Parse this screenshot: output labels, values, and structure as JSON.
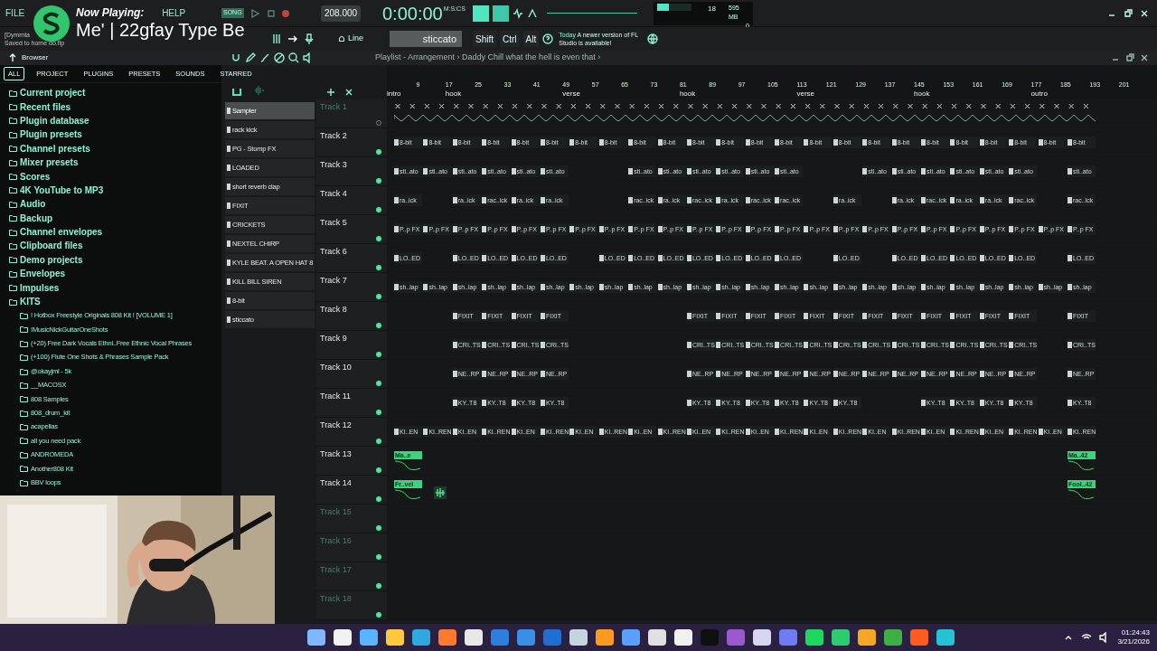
{
  "menu": [
    "FILE",
    "HELP"
  ],
  "now_playing": {
    "heading": "Now Playing:",
    "track": "Me' | 22gfay Type Be"
  },
  "hint_lines": [
    "[Dymmta",
    "Saved to home do.flp"
  ],
  "transport": {
    "mode": "SONG",
    "tempo": "208.000",
    "time": "0:00:00",
    "time_unit": "M:S:CS"
  },
  "monitor": {
    "cpu": "18",
    "memory": "595 MB",
    "voices": "0",
    "cpu_meter": {
      "level": 0.35
    }
  },
  "toolbar": {
    "snap": "Line",
    "pattern": "sticcato",
    "keys": [
      "Shift",
      "Ctrl",
      "Alt"
    ],
    "news_day": "Today",
    "news": "A newer version of FL Studio is available!"
  },
  "browser": {
    "title": "Browser",
    "tabs": [
      {
        "label": "ALL",
        "selected": true
      },
      {
        "label": "PROJECT",
        "selected": false
      },
      {
        "label": "PLUGINS",
        "selected": false
      },
      {
        "label": "PRESETS",
        "selected": false
      },
      {
        "label": "SOUNDS",
        "selected": false
      },
      {
        "label": "STARRED",
        "selected": false
      }
    ],
    "items": [
      {
        "label": "Current project"
      },
      {
        "label": "Recent files"
      },
      {
        "label": "Plugin database"
      },
      {
        "label": "Plugin presets"
      },
      {
        "label": "Channel presets"
      },
      {
        "label": "Mixer presets"
      },
      {
        "label": "Scores"
      },
      {
        "label": "4K YouTube to MP3"
      },
      {
        "label": "Audio"
      },
      {
        "label": "Backup"
      },
      {
        "label": "Channel envelopes"
      },
      {
        "label": "Clipboard files"
      },
      {
        "label": "Demo projects"
      },
      {
        "label": "Envelopes"
      },
      {
        "label": "Impulses"
      },
      {
        "label": "KITS",
        "expanded": true,
        "children": [
          {
            "label": "! Hotbox Freestyle Originals 808 Kit ! [VOLUME 1]"
          },
          {
            "label": "!MusicNickGuitarOneShots"
          },
          {
            "label": "(+20) Free Dark Vocals  Ethni..Free Ethnic Vocal Phrases"
          },
          {
            "label": "(+100) Flute One Shots & Phrases Sample Pack"
          },
          {
            "label": "@okayjml - 5k"
          },
          {
            "label": "__MACOSX"
          },
          {
            "label": "808 Samples"
          },
          {
            "label": "808_drum_kit"
          },
          {
            "label": "acapellas"
          },
          {
            "label": "all you need pack"
          },
          {
            "label": "ANDROMEDA"
          },
          {
            "label": "Another808 Kit"
          },
          {
            "label": "BBV loops"
          }
        ]
      }
    ]
  },
  "channels": [
    {
      "label": "Sampler",
      "selected": true
    },
    {
      "label": "rack kick",
      "selected": false
    },
    {
      "label": "PG - Stomp FX",
      "selected": false
    },
    {
      "label": "LOADED",
      "selected": false
    },
    {
      "label": "short reverb clap",
      "selected": false
    },
    {
      "label": "FIXIT",
      "selected": false
    },
    {
      "label": "CRICKETS",
      "selected": false
    },
    {
      "label": "NEXTEL CHIRP",
      "selected": false
    },
    {
      "label": "KYLE BEAT. A OPEN HAT 8",
      "selected": false
    },
    {
      "label": "KILL BILL SIREN",
      "selected": false
    },
    {
      "label": "8-bit",
      "selected": false
    },
    {
      "label": "sticcato",
      "selected": false
    }
  ],
  "playlist": {
    "title": "Playlist - Arrangement",
    "separator": "›",
    "song": "Daddy Chill what the hell is even that",
    "end": "›",
    "ruler": [
      {
        "marker": "intro"
      },
      {
        "bar": "9"
      },
      {
        "bar": "17",
        "marker": "hook"
      },
      {
        "bar": "25"
      },
      {
        "bar": "33"
      },
      {
        "bar": "41"
      },
      {
        "bar": "49",
        "marker": "verse"
      },
      {
        "bar": "57"
      },
      {
        "bar": "65"
      },
      {
        "bar": "73"
      },
      {
        "bar": "81",
        "marker": "hook"
      },
      {
        "bar": "89"
      },
      {
        "bar": "97"
      },
      {
        "bar": "105"
      },
      {
        "bar": "113",
        "marker": "verse"
      },
      {
        "bar": "121"
      },
      {
        "bar": "129"
      },
      {
        "bar": "137"
      },
      {
        "bar": "145",
        "marker": "hook"
      },
      {
        "bar": "153"
      },
      {
        "bar": "161"
      },
      {
        "bar": "169"
      },
      {
        "bar": "177",
        "marker": "outro"
      },
      {
        "bar": "185"
      },
      {
        "bar": "193"
      },
      {
        "bar": "201"
      }
    ],
    "tracks": [
      {
        "name": "Track 1",
        "kind": "waveform",
        "muted": true
      },
      {
        "name": "Track 2",
        "kind": "pattern",
        "muted": false,
        "slots": [
          {
            "kind": "clip",
            "label": "8-bit"
          },
          {
            "kind": "clip",
            "label": "8-bit"
          },
          {
            "kind": "clip",
            "label": "8-bit"
          },
          {
            "kind": "clip",
            "label": "8-bit"
          },
          {
            "kind": "clip",
            "label": "8-bit"
          },
          {
            "kind": "clip",
            "label": "8-bit"
          },
          {
            "kind": "clip",
            "label": "8-bit"
          },
          {
            "kind": "clip",
            "label": "8-bit"
          },
          {
            "kind": "clip",
            "label": "8-bit"
          },
          {
            "kind": "clip",
            "label": "8-bit"
          },
          {
            "kind": "clip",
            "label": "8-bit"
          },
          {
            "kind": "clip",
            "label": "8-bit"
          },
          {
            "kind": "clip",
            "label": "8-bit"
          },
          {
            "kind": "clip",
            "label": "8-bit"
          },
          {
            "kind": "clip",
            "label": "8-bit"
          },
          {
            "kind": "clip",
            "label": "8-bit"
          },
          {
            "kind": "clip",
            "label": "8-bit"
          },
          {
            "kind": "clip",
            "label": "8-bit"
          },
          {
            "kind": "clip",
            "label": "8-bit"
          },
          {
            "kind": "clip",
            "label": "8-bit"
          },
          {
            "kind": "clip",
            "label": "8-bit"
          },
          {
            "kind": "clip",
            "label": "8-bit"
          },
          {
            "kind": "clip",
            "label": "8-bit"
          },
          {
            "kind": "clip",
            "label": "8-bit"
          }
        ]
      },
      {
        "name": "Track 3",
        "kind": "pattern",
        "muted": false,
        "slots": [
          {
            "kind": "clip",
            "label": "sti..ato"
          },
          {
            "kind": "clip",
            "label": "sti..ato"
          },
          {
            "kind": "clip",
            "label": "sti..ato"
          },
          {
            "kind": "clip",
            "label": "sti..ato"
          },
          {
            "kind": "clip",
            "label": "sti..ato"
          },
          {
            "kind": "clip",
            "label": "sti..ato"
          },
          {
            "kind": "gap"
          },
          {
            "kind": "gap"
          },
          {
            "kind": "clip",
            "label": "sti..ato"
          },
          {
            "kind": "clip",
            "label": "sti..ato"
          },
          {
            "kind": "clip",
            "label": "sti..ato"
          },
          {
            "kind": "clip",
            "label": "sti..ato"
          },
          {
            "kind": "clip",
            "label": "sti..ato"
          },
          {
            "kind": "clip",
            "label": "sti..ato"
          },
          {
            "kind": "gap"
          },
          {
            "kind": "gap"
          },
          {
            "kind": "clip",
            "label": "sti..ato"
          },
          {
            "kind": "clip",
            "label": "sti..ato"
          },
          {
            "kind": "clip",
            "label": "sti..ato"
          },
          {
            "kind": "clip",
            "label": "sti..ato"
          },
          {
            "kind": "clip",
            "label": "sti..ato"
          },
          {
            "kind": "clip",
            "label": "sti..ato"
          },
          {
            "kind": "gap"
          },
          {
            "kind": "clip",
            "label": "sti..ato"
          }
        ]
      },
      {
        "name": "Track 4",
        "kind": "pattern",
        "muted": false,
        "slots": [
          {
            "kind": "clip",
            "label": "ra..ick"
          },
          {
            "kind": "gap"
          },
          {
            "kind": "clip",
            "label": "ra..ick"
          },
          {
            "kind": "clip",
            "label": "rac..ick"
          },
          {
            "kind": "clip",
            "label": "ra..ick"
          },
          {
            "kind": "clip",
            "label": "ra..ick"
          },
          {
            "kind": "gap"
          },
          {
            "kind": "gap"
          },
          {
            "kind": "clip",
            "label": "rac..ick"
          },
          {
            "kind": "clip",
            "label": "ra..ick"
          },
          {
            "kind": "clip",
            "label": "rac..ick"
          },
          {
            "kind": "clip",
            "label": "ra..ick"
          },
          {
            "kind": "clip",
            "label": "rac..ick"
          },
          {
            "kind": "clip",
            "label": "rac..ick"
          },
          {
            "kind": "gap"
          },
          {
            "kind": "clip",
            "label": "ra..ick"
          },
          {
            "kind": "gap"
          },
          {
            "kind": "clip",
            "label": "ra..ick"
          },
          {
            "kind": "clip",
            "label": "rac..ick"
          },
          {
            "kind": "clip",
            "label": "ra..ick"
          },
          {
            "kind": "clip",
            "label": "ra..ick"
          },
          {
            "kind": "clip",
            "label": "rac..ick"
          },
          {
            "kind": "gap"
          },
          {
            "kind": "clip",
            "label": "rac..ick"
          }
        ]
      },
      {
        "name": "Track 5",
        "kind": "pattern",
        "muted": false,
        "slots": [
          {
            "kind": "clip",
            "label": "P..p FX"
          },
          {
            "kind": "clip",
            "label": "P..p FX"
          },
          {
            "kind": "clip",
            "label": "P..p FX"
          },
          {
            "kind": "clip",
            "label": "P..p FX"
          },
          {
            "kind": "clip",
            "label": "P..p FX"
          },
          {
            "kind": "clip",
            "label": "P..p FX"
          },
          {
            "kind": "clip",
            "label": "P..p FX"
          },
          {
            "kind": "clip",
            "label": "P..p FX"
          },
          {
            "kind": "clip",
            "label": "P..p FX"
          },
          {
            "kind": "clip",
            "label": "P..p FX"
          },
          {
            "kind": "clip",
            "label": "P..p FX"
          },
          {
            "kind": "clip",
            "label": "P..p FX"
          },
          {
            "kind": "clip",
            "label": "P..p FX"
          },
          {
            "kind": "clip",
            "label": "P..p FX"
          },
          {
            "kind": "clip",
            "label": "P..p FX"
          },
          {
            "kind": "clip",
            "label": "P..p FX"
          },
          {
            "kind": "clip",
            "label": "P..p FX"
          },
          {
            "kind": "clip",
            "label": "P..p FX"
          },
          {
            "kind": "clip",
            "label": "P..p FX"
          },
          {
            "kind": "clip",
            "label": "P..p FX"
          },
          {
            "kind": "clip",
            "label": "P..p FX"
          },
          {
            "kind": "clip",
            "label": "P..p FX"
          },
          {
            "kind": "clip",
            "label": "P..p FX"
          },
          {
            "kind": "clip",
            "label": "P..p FX"
          }
        ]
      },
      {
        "name": "Track 6",
        "kind": "pattern",
        "muted": false,
        "slots": [
          {
            "kind": "clip",
            "label": "LO..ED"
          },
          {
            "kind": "gap"
          },
          {
            "kind": "clip",
            "label": "LO..ED"
          },
          {
            "kind": "clip",
            "label": "LO..ED"
          },
          {
            "kind": "clip",
            "label": "LO..ED"
          },
          {
            "kind": "clip",
            "label": "LO..ED"
          },
          {
            "kind": "gap"
          },
          {
            "kind": "clip",
            "label": "LO..ED"
          },
          {
            "kind": "clip",
            "label": "LO..ED"
          },
          {
            "kind": "clip",
            "label": "LO..ED"
          },
          {
            "kind": "clip",
            "label": "LO..ED"
          },
          {
            "kind": "clip",
            "label": "LO..ED"
          },
          {
            "kind": "clip",
            "label": "LO..ED"
          },
          {
            "kind": "clip",
            "label": "LO..ED"
          },
          {
            "kind": "gap"
          },
          {
            "kind": "clip",
            "label": "LO..ED"
          },
          {
            "kind": "gap"
          },
          {
            "kind": "clip",
            "label": "LO..ED"
          },
          {
            "kind": "clip",
            "label": "LO..ED"
          },
          {
            "kind": "clip",
            "label": "LO..ED"
          },
          {
            "kind": "clip",
            "label": "LO..ED"
          },
          {
            "kind": "clip",
            "label": "LO..ED"
          },
          {
            "kind": "gap"
          },
          {
            "kind": "clip",
            "label": "LO..ED"
          }
        ]
      },
      {
        "name": "Track 7",
        "kind": "pattern",
        "muted": false,
        "slots": [
          {
            "kind": "clip",
            "label": "sh..lap"
          },
          {
            "kind": "clip",
            "label": "sh..lap"
          },
          {
            "kind": "clip",
            "label": "sh..lap"
          },
          {
            "kind": "clip",
            "label": "sh..lap"
          },
          {
            "kind": "clip",
            "label": "sh..lap"
          },
          {
            "kind": "clip",
            "label": "sh..lap"
          },
          {
            "kind": "clip",
            "label": "sh..lap"
          },
          {
            "kind": "clip",
            "label": "sh..lap"
          },
          {
            "kind": "clip",
            "label": "sh..lap"
          },
          {
            "kind": "clip",
            "label": "sh..lap"
          },
          {
            "kind": "clip",
            "label": "sh..lap"
          },
          {
            "kind": "clip",
            "label": "sh..lap"
          },
          {
            "kind": "clip",
            "label": "sh..lap"
          },
          {
            "kind": "clip",
            "label": "sh..lap"
          },
          {
            "kind": "clip",
            "label": "sh..lap"
          },
          {
            "kind": "clip",
            "label": "sh..lap"
          },
          {
            "kind": "clip",
            "label": "sh..lap"
          },
          {
            "kind": "clip",
            "label": "sh..lap"
          },
          {
            "kind": "clip",
            "label": "sh..lap"
          },
          {
            "kind": "clip",
            "label": "sh..lap"
          },
          {
            "kind": "clip",
            "label": "sh..lap"
          },
          {
            "kind": "clip",
            "label": "sh..lap"
          },
          {
            "kind": "clip",
            "label": "sh..lap"
          },
          {
            "kind": "clip",
            "label": "sh..lap"
          }
        ]
      },
      {
        "name": "Track 8",
        "kind": "pattern",
        "muted": false,
        "slots": [
          {
            "kind": "gap"
          },
          {
            "kind": "gap"
          },
          {
            "kind": "clip",
            "label": "FIXIT"
          },
          {
            "kind": "clip",
            "label": "FIXIT"
          },
          {
            "kind": "clip",
            "label": "FIXIT"
          },
          {
            "kind": "clip",
            "label": "FIXIT"
          },
          {
            "kind": "gap"
          },
          {
            "kind": "gap"
          },
          {
            "kind": "gap"
          },
          {
            "kind": "gap"
          },
          {
            "kind": "clip",
            "label": "FIXIT"
          },
          {
            "kind": "clip",
            "label": "FIXIT"
          },
          {
            "kind": "clip",
            "label": "FIXIT"
          },
          {
            "kind": "clip",
            "label": "FIXIT"
          },
          {
            "kind": "clip",
            "label": "FIXIT"
          },
          {
            "kind": "clip",
            "label": "FIXIT"
          },
          {
            "kind": "clip",
            "label": "FIXIT"
          },
          {
            "kind": "clip",
            "label": "FIXIT"
          },
          {
            "kind": "clip",
            "label": "FIXIT"
          },
          {
            "kind": "clip",
            "label": "FIXIT"
          },
          {
            "kind": "clip",
            "label": "FIXIT"
          },
          {
            "kind": "clip",
            "label": "FIXIT"
          },
          {
            "kind": "gap"
          },
          {
            "kind": "clip",
            "label": "FIXIT"
          }
        ]
      },
      {
        "name": "Track 9",
        "kind": "pattern",
        "muted": false,
        "slots": [
          {
            "kind": "gap"
          },
          {
            "kind": "gap"
          },
          {
            "kind": "clip",
            "label": "CRI..TS"
          },
          {
            "kind": "clip",
            "label": "CRI..TS"
          },
          {
            "kind": "clip",
            "label": "CRI..TS"
          },
          {
            "kind": "clip",
            "label": "CRI..TS"
          },
          {
            "kind": "gap"
          },
          {
            "kind": "gap"
          },
          {
            "kind": "gap"
          },
          {
            "kind": "gap"
          },
          {
            "kind": "clip",
            "label": "CRI..TS"
          },
          {
            "kind": "clip",
            "label": "CRI..TS"
          },
          {
            "kind": "clip",
            "label": "CRI..TS"
          },
          {
            "kind": "clip",
            "label": "CRI..TS"
          },
          {
            "kind": "clip",
            "label": "CRI..TS"
          },
          {
            "kind": "clip",
            "label": "CRI..TS"
          },
          {
            "kind": "clip",
            "label": "CRI..TS"
          },
          {
            "kind": "clip",
            "label": "CRI..TS"
          },
          {
            "kind": "clip",
            "label": "CRI..TS"
          },
          {
            "kind": "clip",
            "label": "CRI..TS"
          },
          {
            "kind": "clip",
            "label": "CRI..TS"
          },
          {
            "kind": "clip",
            "label": "CRI..TS"
          },
          {
            "kind": "gap"
          },
          {
            "kind": "clip",
            "label": "CRI..TS"
          }
        ]
      },
      {
        "name": "Track 10",
        "kind": "pattern",
        "muted": false,
        "slots": [
          {
            "kind": "gap"
          },
          {
            "kind": "gap"
          },
          {
            "kind": "clip",
            "label": "NE..RP"
          },
          {
            "kind": "clip",
            "label": "NE..RP"
          },
          {
            "kind": "clip",
            "label": "NE..RP"
          },
          {
            "kind": "clip",
            "label": "NE..RP"
          },
          {
            "kind": "gap"
          },
          {
            "kind": "gap"
          },
          {
            "kind": "gap"
          },
          {
            "kind": "gap"
          },
          {
            "kind": "clip",
            "label": "NE..RP"
          },
          {
            "kind": "clip",
            "label": "NE..RP"
          },
          {
            "kind": "clip",
            "label": "NE..RP"
          },
          {
            "kind": "clip",
            "label": "NE..RP"
          },
          {
            "kind": "clip",
            "label": "NE..RP"
          },
          {
            "kind": "clip",
            "label": "NE..RP"
          },
          {
            "kind": "clip",
            "label": "NE..RP"
          },
          {
            "kind": "clip",
            "label": "NE..RP"
          },
          {
            "kind": "clip",
            "label": "NE..RP"
          },
          {
            "kind": "clip",
            "label": "NE..RP"
          },
          {
            "kind": "clip",
            "label": "NE..RP"
          },
          {
            "kind": "clip",
            "label": "NE..RP"
          },
          {
            "kind": "gap"
          },
          {
            "kind": "clip",
            "label": "NE..RP"
          }
        ]
      },
      {
        "name": "Track 11",
        "kind": "pattern",
        "muted": false,
        "slots": [
          {
            "kind": "gap"
          },
          {
            "kind": "gap"
          },
          {
            "kind": "clip",
            "label": "KY..T8"
          },
          {
            "kind": "clip",
            "label": "KY..T8"
          },
          {
            "kind": "clip",
            "label": "KY..T8"
          },
          {
            "kind": "clip",
            "label": "KY..T8"
          },
          {
            "kind": "gap"
          },
          {
            "kind": "gap"
          },
          {
            "kind": "gap"
          },
          {
            "kind": "gap"
          },
          {
            "kind": "clip",
            "label": "KY..T8"
          },
          {
            "kind": "clip",
            "label": "KY..T8"
          },
          {
            "kind": "clip",
            "label": "KY..T8"
          },
          {
            "kind": "clip",
            "label": "KY..T8"
          },
          {
            "kind": "clip",
            "label": "KY..T8"
          },
          {
            "kind": "clip",
            "label": "KY..T8"
          },
          {
            "kind": "gap"
          },
          {
            "kind": "gap"
          },
          {
            "kind": "clip",
            "label": "KY..T8"
          },
          {
            "kind": "clip",
            "label": "KY..T8"
          },
          {
            "kind": "clip",
            "label": "KY..T8"
          },
          {
            "kind": "clip",
            "label": "KY..T8"
          },
          {
            "kind": "gap"
          },
          {
            "kind": "clip",
            "label": "KY..T8"
          }
        ]
      },
      {
        "name": "Track 12",
        "kind": "pattern",
        "muted": false,
        "slots": [
          {
            "kind": "clip",
            "label": "KI..EN"
          },
          {
            "kind": "clip",
            "label": "KI..REN"
          },
          {
            "kind": "clip",
            "label": "KI..EN"
          },
          {
            "kind": "clip",
            "label": "KI..REN"
          },
          {
            "kind": "clip",
            "label": "KI..EN"
          },
          {
            "kind": "clip",
            "label": "KI..REN"
          },
          {
            "kind": "clip",
            "label": "KI..EN"
          },
          {
            "kind": "clip",
            "label": "KI..REN"
          },
          {
            "kind": "clip",
            "label": "KI..EN"
          },
          {
            "kind": "clip",
            "label": "KI..REN"
          },
          {
            "kind": "clip",
            "label": "KI..EN"
          },
          {
            "kind": "clip",
            "label": "KI..REN"
          },
          {
            "kind": "clip",
            "label": "KI..EN"
          },
          {
            "kind": "clip",
            "label": "KI..REN"
          },
          {
            "kind": "clip",
            "label": "KI..EN"
          },
          {
            "kind": "clip",
            "label": "KI..REN"
          },
          {
            "kind": "clip",
            "label": "KI..EN"
          },
          {
            "kind": "clip",
            "label": "KI..REN"
          },
          {
            "kind": "clip",
            "label": "KI..EN"
          },
          {
            "kind": "clip",
            "label": "KI..REN"
          },
          {
            "kind": "clip",
            "label": "KI..EN"
          },
          {
            "kind": "clip",
            "label": "KI..REN"
          },
          {
            "kind": "clip",
            "label": "KI..EN"
          },
          {
            "kind": "clip",
            "label": "KI..REN"
          }
        ]
      },
      {
        "name": "Track 13",
        "kind": "audio",
        "muted": false,
        "slots": [
          {
            "kind": "clip",
            "label": "Ma..e"
          },
          {
            "kind": "gap"
          },
          {
            "kind": "gap"
          },
          {
            "kind": "gap"
          },
          {
            "kind": "gap"
          },
          {
            "kind": "gap"
          },
          {
            "kind": "gap"
          },
          {
            "kind": "gap"
          },
          {
            "kind": "gap"
          },
          {
            "kind": "gap"
          },
          {
            "kind": "gap"
          },
          {
            "kind": "gap"
          },
          {
            "kind": "gap"
          },
          {
            "kind": "gap"
          },
          {
            "kind": "gap"
          },
          {
            "kind": "gap"
          },
          {
            "kind": "gap"
          },
          {
            "kind": "gap"
          },
          {
            "kind": "gap"
          },
          {
            "kind": "gap"
          },
          {
            "kind": "gap"
          },
          {
            "kind": "gap"
          },
          {
            "kind": "gap"
          },
          {
            "kind": "clip",
            "label": "Ma..42"
          }
        ]
      },
      {
        "name": "Track 14",
        "kind": "audio",
        "muted": false,
        "slots": [
          {
            "kind": "clip",
            "label": "Fr..vel"
          },
          {
            "kind": "mini"
          },
          {
            "kind": "gap"
          },
          {
            "kind": "gap"
          },
          {
            "kind": "gap"
          },
          {
            "kind": "gap"
          },
          {
            "kind": "gap"
          },
          {
            "kind": "gap"
          },
          {
            "kind": "gap"
          },
          {
            "kind": "gap"
          },
          {
            "kind": "gap"
          },
          {
            "kind": "gap"
          },
          {
            "kind": "gap"
          },
          {
            "kind": "gap"
          },
          {
            "kind": "gap"
          },
          {
            "kind": "gap"
          },
          {
            "kind": "gap"
          },
          {
            "kind": "gap"
          },
          {
            "kind": "gap"
          },
          {
            "kind": "gap"
          },
          {
            "kind": "gap"
          },
          {
            "kind": "gap"
          },
          {
            "kind": "gap"
          },
          {
            "kind": "clip",
            "label": "Fool..42"
          }
        ]
      },
      {
        "name": "Track 15",
        "kind": "empty",
        "muted": false
      },
      {
        "name": "Track 16",
        "kind": "empty",
        "muted": false
      },
      {
        "name": "Track 17",
        "kind": "empty",
        "muted": false
      },
      {
        "name": "Track 18",
        "kind": "empty",
        "muted": false
      }
    ]
  },
  "clock": {
    "time": "01:24:43",
    "date": "3/21/2026"
  }
}
